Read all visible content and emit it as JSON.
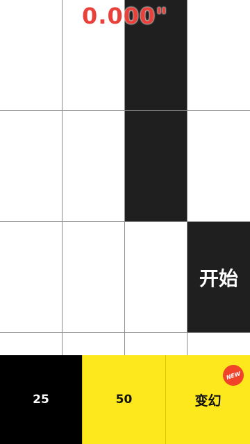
{
  "timer": {
    "text": "0.000\""
  },
  "board": {
    "start_label": "开始",
    "rows": [
      [
        "white",
        "white",
        "black",
        "white"
      ],
      [
        "white",
        "white",
        "black",
        "white"
      ],
      [
        "white",
        "white",
        "white",
        "black"
      ],
      [
        "white",
        "white",
        "white",
        "white"
      ]
    ]
  },
  "modes": {
    "items": [
      {
        "label": "25"
      },
      {
        "label": "50"
      },
      {
        "label": "变幻",
        "badge": "NEW"
      }
    ]
  },
  "colors": {
    "tile_black": "#1f1f1f",
    "timer_red": "#e8403a",
    "button_yellow": "#fce81c",
    "badge_red": "#f0432a"
  }
}
